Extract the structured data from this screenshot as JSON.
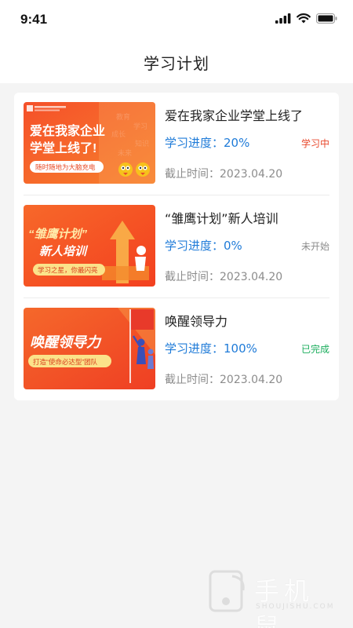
{
  "status_bar": {
    "time": "9:41"
  },
  "nav": {
    "title": "学习计划"
  },
  "courses": [
    {
      "title": "爱在我家企业学堂上线了",
      "progress_label": "学习进度：",
      "progress_value": "20%",
      "status": "学习中",
      "status_color": "#e8482c",
      "deadline_label": "截止时间：",
      "deadline_value": "2023.04.20",
      "thumb": {
        "line1": "爱在我家企业",
        "line2": "学堂上线了!",
        "badge": "随时随地为大脑充电",
        "logo_text": "爱在我家企业学堂"
      }
    },
    {
      "title": "“雏鹰计划”新人培训",
      "progress_label": "学习进度：",
      "progress_value": "0%",
      "status": "未开始",
      "status_color": "#8c8c8c",
      "deadline_label": "截止时间：",
      "deadline_value": "2023.04.20",
      "thumb": {
        "line1": "“雏鹰计划”",
        "line2": "新人培训",
        "badge": "学习之星，你最闪亮"
      }
    },
    {
      "title": "唤醒领导力",
      "progress_label": "学习进度：",
      "progress_value": "100%",
      "status": "已完成",
      "status_color": "#1aad5c",
      "deadline_label": "截止时间：",
      "deadline_value": "2023.04.20",
      "thumb": {
        "line1": "唤醒领导力",
        "badge": "打造“使命必达型”团队"
      }
    }
  ],
  "watermark": {
    "text": "手机鼠",
    "sub": "SHOUJISHU.COM"
  },
  "colors": {
    "accent_blue": "#1f7bd8",
    "banner_orange": "#f26a21"
  }
}
